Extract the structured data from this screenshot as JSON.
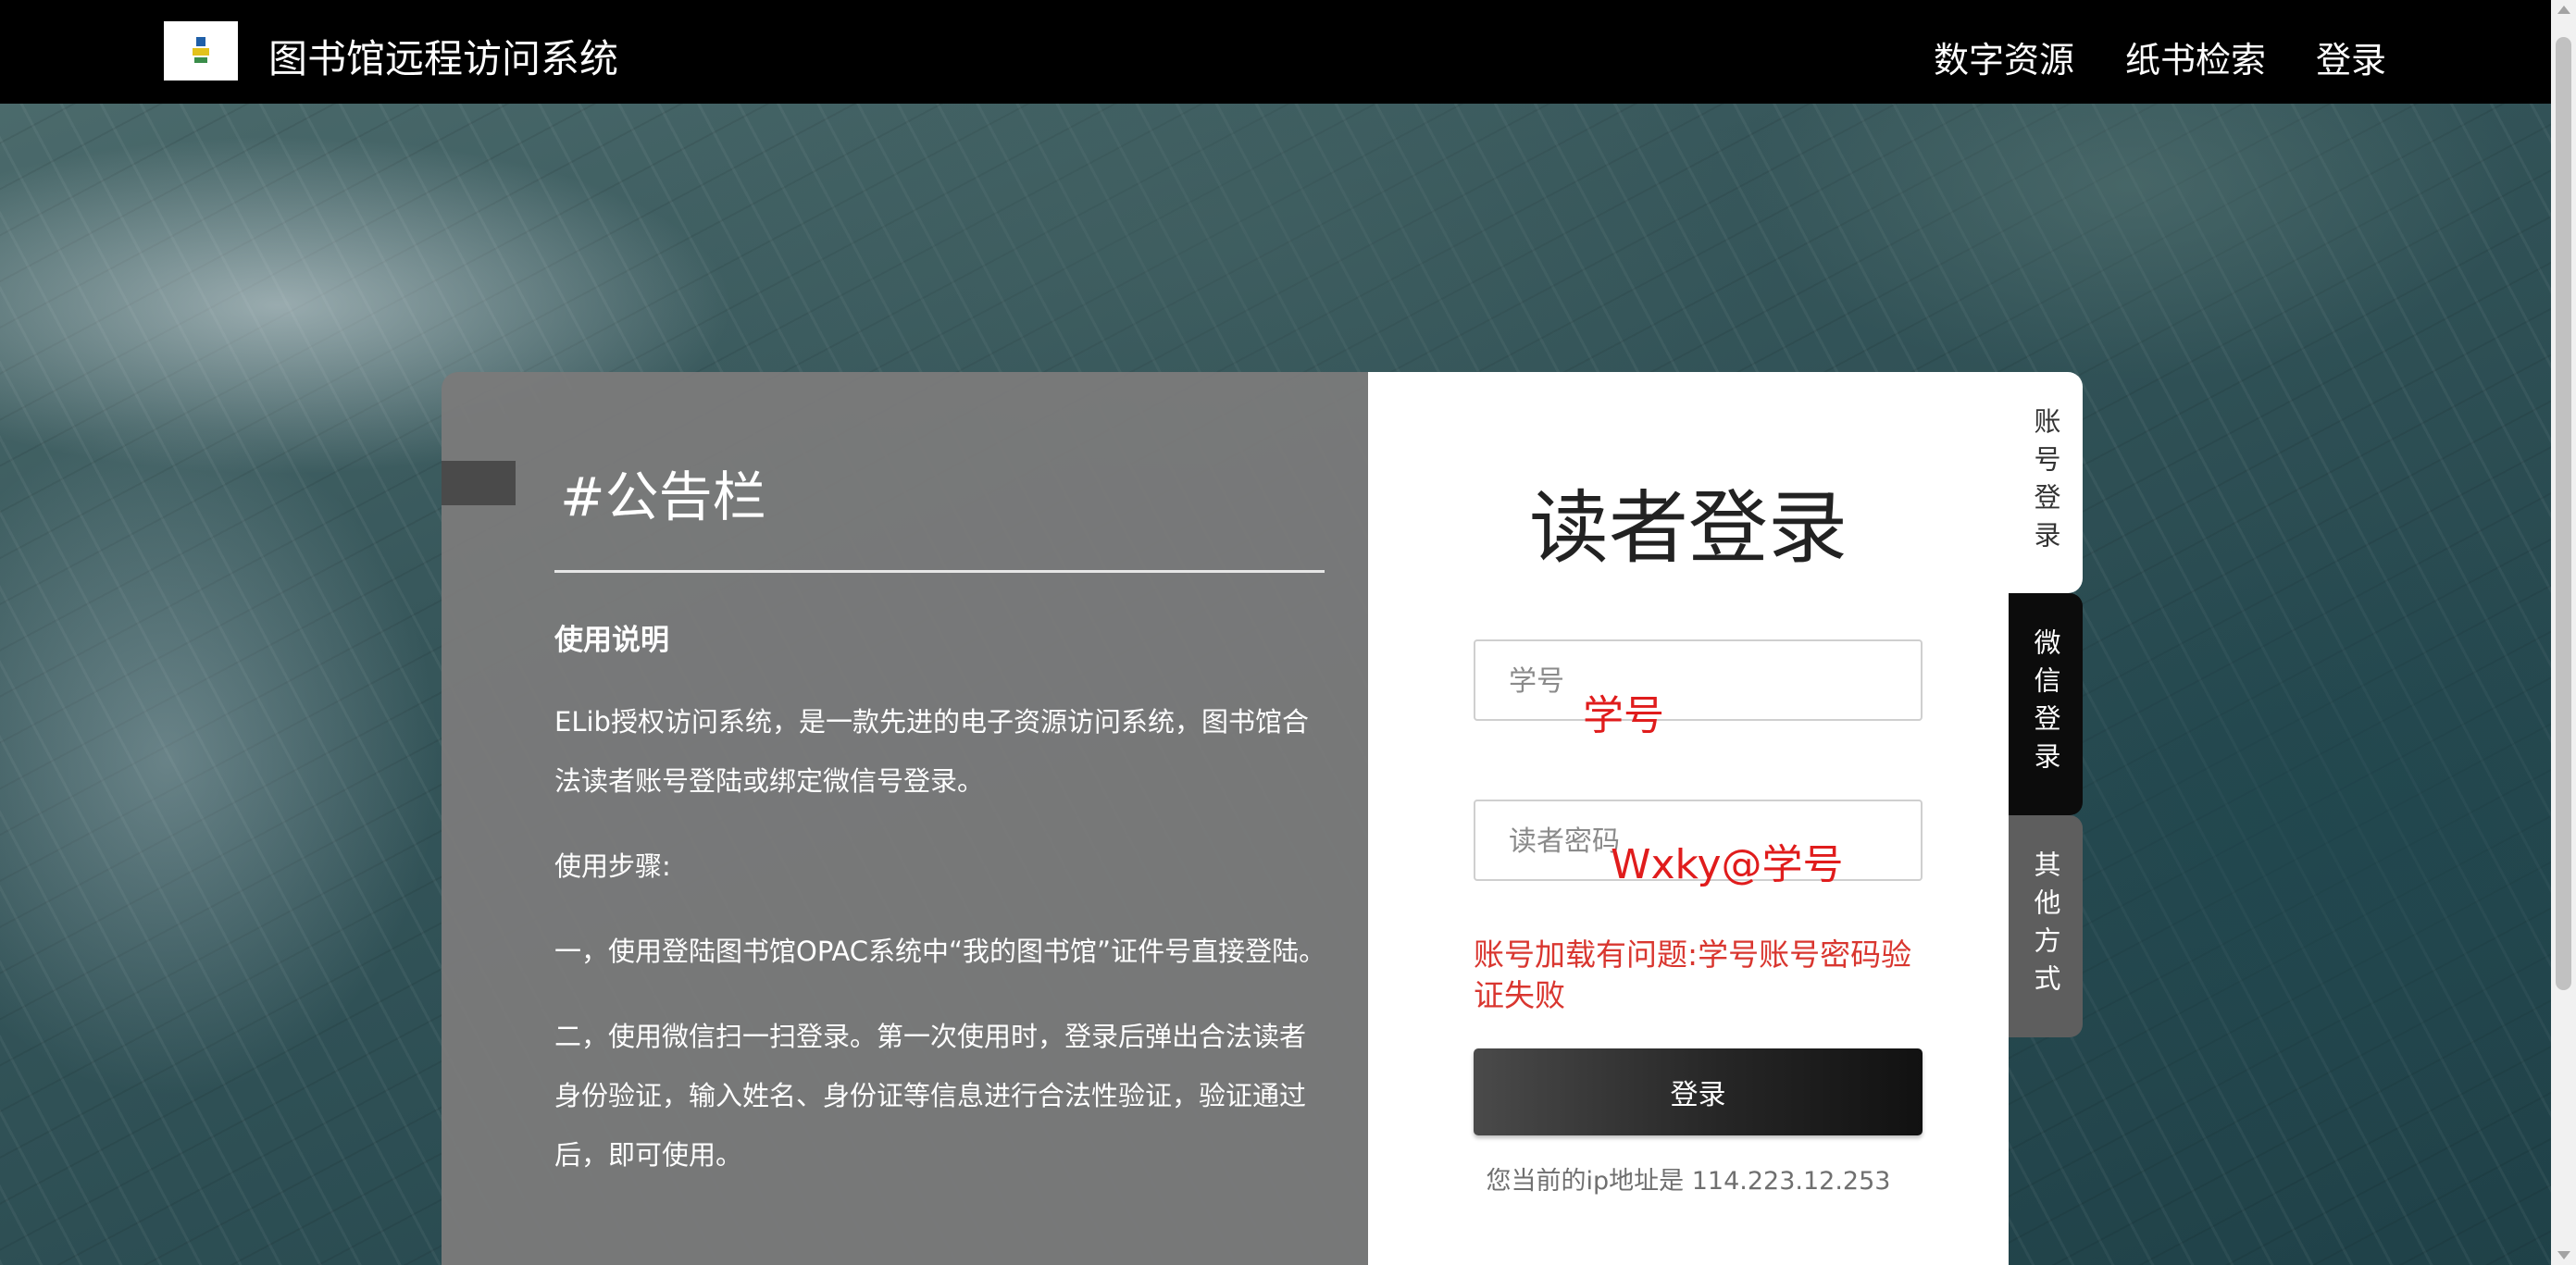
{
  "header": {
    "site_title": "图书馆远程访问系统",
    "nav": [
      "数字资源",
      "纸书检索",
      "登录"
    ]
  },
  "notice": {
    "title": "#公告栏",
    "subtitle": "使用说明",
    "paragraphs": [
      "ELib授权访问系统，是一款先进的电子资源访问系统，图书馆合法读者账号登陆或绑定微信号登录。",
      "使用步骤:",
      "一，使用登陆图书馆OPAC系统中“我的图书馆”证件号直接登陆。",
      "二，使用微信扫一扫登录。第一次使用时，登录后弹出合法读者身份验证，输入姓名、身份证等信息进行合法性验证，验证通过后，即可使用。"
    ]
  },
  "login": {
    "title": "读者登录",
    "username_placeholder": "学号",
    "password_placeholder": "读者密码",
    "username_note": "学号",
    "password_note": "Wxky@学号",
    "error": "账号加载有问题:学号账号密码验证失败",
    "button": "登录",
    "ip_text": "您当前的ip地址是 114.223.12.253"
  },
  "tabs": [
    "账号登录",
    "微信登录",
    "其他方式"
  ],
  "colors": {
    "header_bg": "#000000",
    "error": "#d9362f",
    "overlay_note": "#e01c1c",
    "active_tab": "#ffffff",
    "wechat_tab": "#0c0c0c",
    "other_tab": "#5e5e5e"
  }
}
